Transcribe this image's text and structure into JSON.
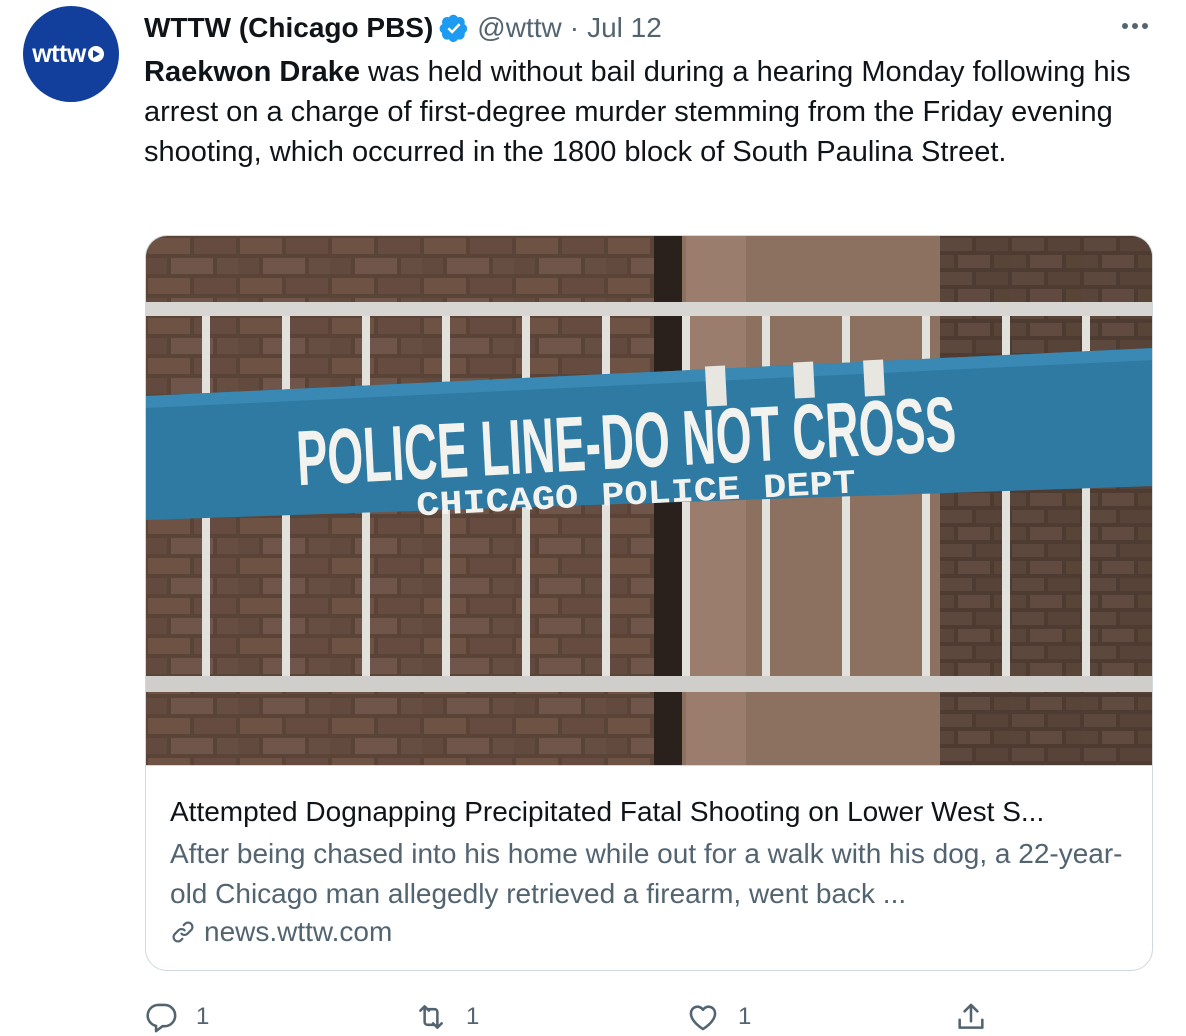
{
  "tweet": {
    "avatar_label": "wttw",
    "author_name": "WTTW (Chicago PBS)",
    "handle": "@wttw",
    "separator": "·",
    "date": "Jul 12",
    "text_bold": "Raekwon Drake",
    "text_rest": " was held without bail during a hearing Monday following his arrest on a charge of first-degree murder stemming from the Friday evening shooting, which occurred in the 1800 block of South Paulina Street."
  },
  "card": {
    "image_sign_main": "POLICE LINE-DO NOT CROSS",
    "image_sign_sub": "CHICAGO POLICE DEPT",
    "title": "Attempted Dognapping Precipitated Fatal Shooting on Lower West S...",
    "description": "After being chased into his home while out for a walk with his dog, a 22-year-old Chicago man allegedly retrieved a firearm, went back ...",
    "domain": "news.wttw.com"
  },
  "actions": {
    "reply_count": "1",
    "retweet_count": "1",
    "like_count": "1"
  },
  "colors": {
    "avatar_bg": "#123f9c",
    "verified": "#1d9bf0",
    "secondary_text": "#536471",
    "border": "#cfd9de",
    "sign_blue": "#2f7aa3"
  },
  "icons": {
    "more": "more-icon",
    "verified": "verified-badge-icon",
    "link": "link-icon",
    "reply": "reply-icon",
    "retweet": "retweet-icon",
    "like": "like-icon",
    "share": "share-icon"
  }
}
